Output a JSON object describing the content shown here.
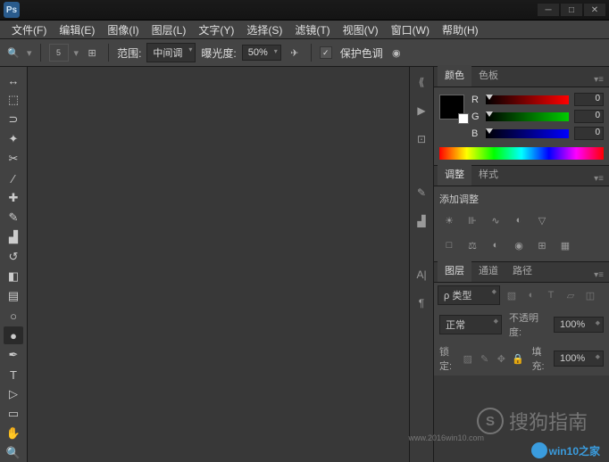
{
  "menu": [
    "文件(F)",
    "编辑(E)",
    "图像(I)",
    "图层(L)",
    "文字(Y)",
    "选择(S)",
    "滤镜(T)",
    "视图(V)",
    "窗口(W)",
    "帮助(H)"
  ],
  "options": {
    "brushsize": "5",
    "range_label": "范围:",
    "range_value": "中间调",
    "exposure_label": "曝光度:",
    "exposure_value": "50%",
    "protect": "保护色调"
  },
  "color_panel": {
    "tabs": [
      "颜色",
      "色板"
    ],
    "channels": [
      "R",
      "G",
      "B"
    ],
    "values": {
      "r": "0",
      "g": "0",
      "b": "0"
    }
  },
  "adjust_panel": {
    "tabs": [
      "调整",
      "样式"
    ],
    "add": "添加调整"
  },
  "layer_panel": {
    "tabs": [
      "图层",
      "通道",
      "路径"
    ],
    "kind": "ρ 类型",
    "blend": "正常",
    "opacity_label": "不透明度:",
    "opacity_value": "100%",
    "lock_label": "锁定:",
    "fill_label": "填充:",
    "fill_value": "100%"
  },
  "watermark1": "搜狗指南",
  "watermark2": "win10之家",
  "watermark3": "www.2016win10.com"
}
